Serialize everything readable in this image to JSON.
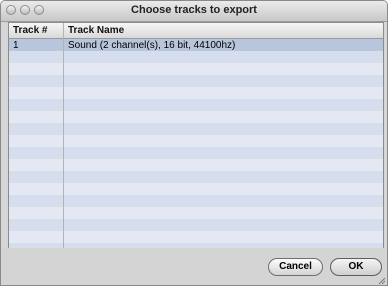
{
  "window": {
    "title": "Choose tracks to export"
  },
  "table": {
    "columns": [
      "Track #",
      "Track Name"
    ],
    "rows": [
      {
        "track_number": "1",
        "track_name": "Sound (2 channel(s), 16 bit, 44100hz)",
        "selected": true
      }
    ]
  },
  "buttons": {
    "cancel_label": "Cancel",
    "ok_label": "OK"
  }
}
